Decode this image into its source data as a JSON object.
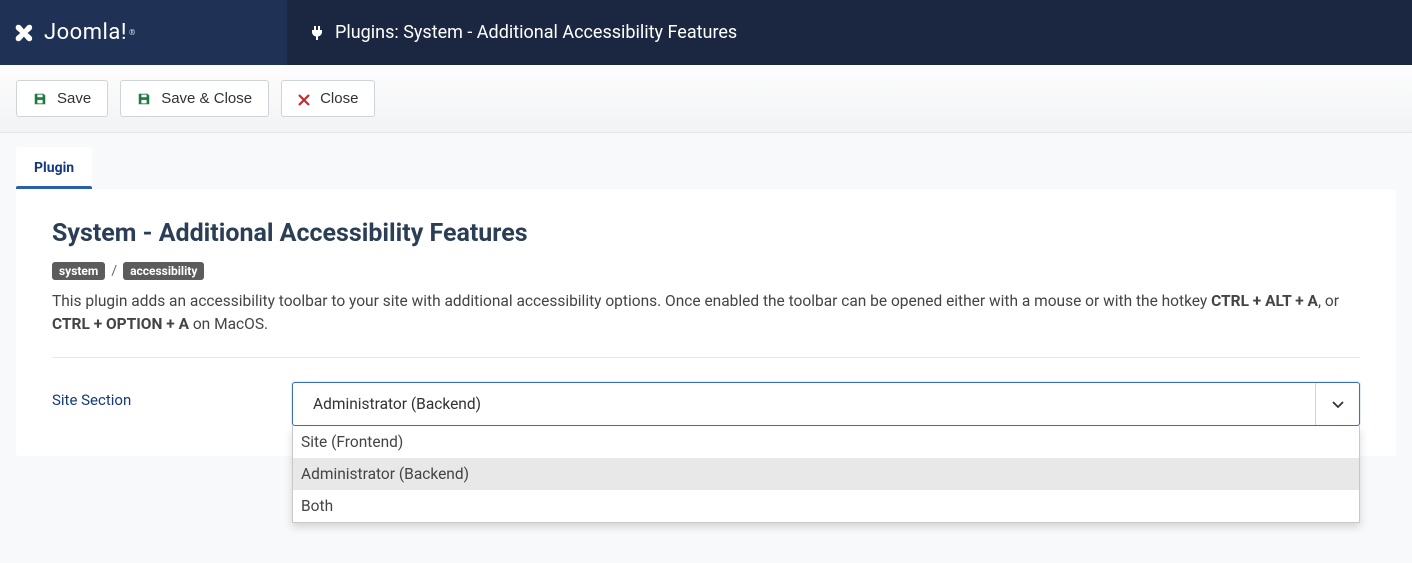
{
  "brand": {
    "name": "Joomla!",
    "reg": "®"
  },
  "header": {
    "title": "Plugins: System - Additional Accessibility Features"
  },
  "toolbar": {
    "save": "Save",
    "saveClose": "Save & Close",
    "close": "Close"
  },
  "tabs": [
    {
      "label": "Plugin"
    }
  ],
  "plugin": {
    "title": "System - Additional Accessibility Features",
    "tag1": "system",
    "tag2": "accessibility",
    "desc_prefix": "This plugin adds an accessibility toolbar to your site with additional accessibility options. Once enabled the toolbar can be opened either with a mouse or with the hotkey ",
    "hotkey1": "CTRL + ALT + A",
    "desc_mid": ", or ",
    "hotkey2": "CTRL + OPTION + A",
    "desc_suffix": " on MacOS."
  },
  "form": {
    "siteSection": {
      "label": "Site Section",
      "selected": "Administrator (Backend)",
      "options": [
        "Site (Frontend)",
        "Administrator (Backend)",
        "Both"
      ]
    }
  }
}
